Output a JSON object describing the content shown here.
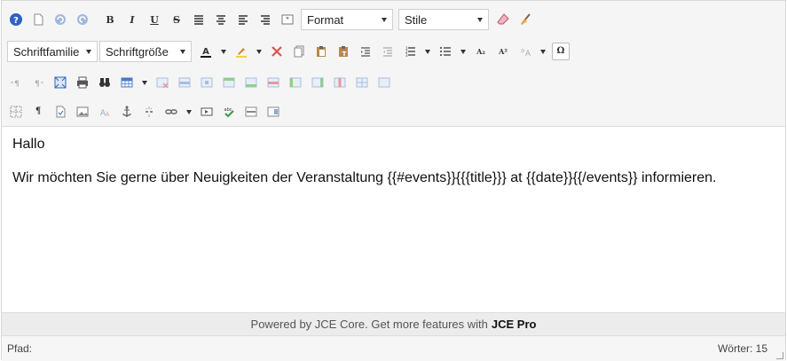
{
  "toolbar": {
    "format_label": "Format",
    "style_label": "Stile",
    "font_family_label": "Schriftfamilie",
    "font_size_label": "Schriftgröße",
    "bold_glyph": "B",
    "italic_glyph": "I",
    "underline_glyph": "U",
    "strike_glyph": "S",
    "subscript_glyph": "A₂",
    "superscript_glyph": "A²",
    "omega_glyph": "Ω",
    "pilcrow_glyph": "¶"
  },
  "content": {
    "line1": "Hallo",
    "line2": "Wir möchten Sie gerne über Neuigkeiten der Veranstaltung {{#events}}{{{title}}} at {{date}}{{/events}} informieren."
  },
  "powered": {
    "text": "Powered by JCE Core. Get more features with",
    "brand": "JCE Pro"
  },
  "status": {
    "path_label": "Pfad:",
    "words_label": "Wörter: 15"
  },
  "colors": {
    "help_blue": "#2f62c7",
    "accent_red": "#d9534f",
    "highlight_yellow": "#f3d23a"
  }
}
